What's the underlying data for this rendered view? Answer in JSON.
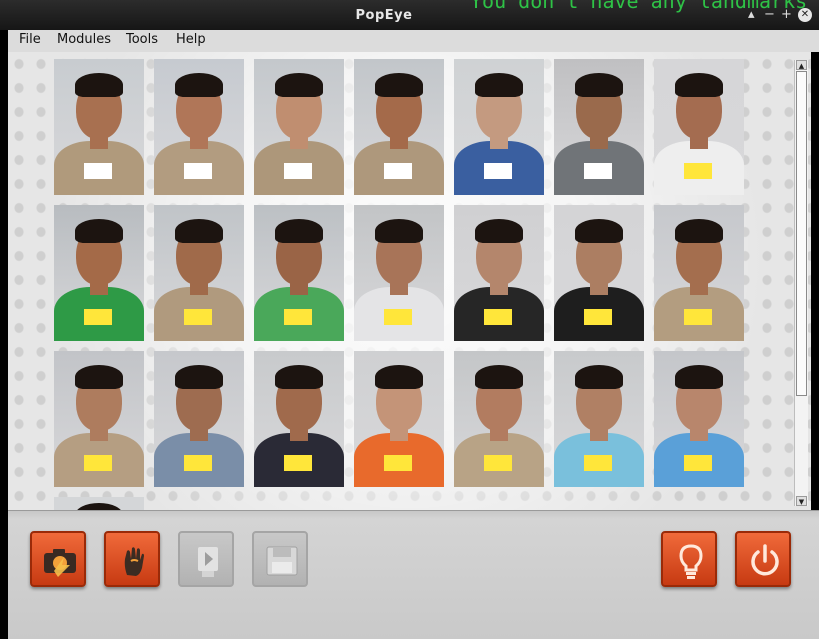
{
  "window": {
    "title": "PopEye",
    "overlay_text": "You don't have any landmarks",
    "controls": {
      "collapse": "▴",
      "minimize": "−",
      "maximize": "+",
      "close": "✕"
    }
  },
  "menu": {
    "items": [
      "File",
      "Modules",
      "Tools",
      "Help"
    ]
  },
  "gallery": {
    "rows": [
      [
        {
          "wall": "#c8ccd0",
          "shirt": "#b09a7c",
          "skin": "#a87050",
          "tag": "#ffffff",
          "tag_text": ""
        },
        {
          "wall": "#c6cad0",
          "shirt": "#b29c80",
          "skin": "#b07658",
          "tag": "#ffffff",
          "tag_text": ""
        },
        {
          "wall": "#c4c8cc",
          "shirt": "#ad977a",
          "skin": "#c08e70",
          "tag": "#ffffff",
          "tag_text": ""
        },
        {
          "wall": "#c2c6ca",
          "shirt": "#ae987c",
          "skin": "#a46a4a",
          "tag": "#ffffff",
          "tag_text": ""
        },
        {
          "wall": "#cfd2d4",
          "shirt": "#3a5fa0",
          "skin": "#c49a80",
          "tag": "#ffffff",
          "tag_text": ""
        },
        {
          "wall": "#c0c0c2",
          "shirt": "#707478",
          "skin": "#9a6a4c",
          "tag": "#ffffff",
          "tag_text": ""
        },
        {
          "wall": "#d6d6d8",
          "shirt": "#eeeeee",
          "skin": "#a46c50",
          "tag": "#ffe63a",
          "tag_text": ""
        }
      ],
      [
        {
          "wall": "#b8bcc0",
          "shirt": "#2e9a46",
          "skin": "#a46a48",
          "tag": "#ffe63a",
          "tag_text": ""
        },
        {
          "wall": "#c0c4c8",
          "shirt": "#b09a7e",
          "skin": "#a06a4a",
          "tag": "#ffe63a",
          "tag_text": ""
        },
        {
          "wall": "#bcc0c4",
          "shirt": "#4aa85a",
          "skin": "#9a6446",
          "tag": "#ffe63a",
          "tag_text": ""
        },
        {
          "wall": "#c2c4c6",
          "shirt": "#e4e4e6",
          "skin": "#a87458",
          "tag": "#ffe63a",
          "tag_text": ""
        },
        {
          "wall": "#d0d0d2",
          "shirt": "#262626",
          "skin": "#b4866c",
          "tag": "#ffe63a",
          "tag_text": ""
        },
        {
          "wall": "#d4d4d6",
          "shirt": "#1e1e1e",
          "skin": "#ac7e62",
          "tag": "#ffe63a",
          "tag_text": ""
        },
        {
          "wall": "#c6c8cc",
          "shirt": "#b39d80",
          "skin": "#a46e4e",
          "tag": "#ffe63a",
          "tag_text": ""
        }
      ],
      [
        {
          "wall": "#c2c4c8",
          "shirt": "#b59e82",
          "skin": "#ae7c5e",
          "tag": "#ffe63a",
          "tag_text": ""
        },
        {
          "wall": "#c6c8cc",
          "shirt": "#7a8ea8",
          "skin": "#9e6c50",
          "tag": "#ffe63a",
          "tag_text": ""
        },
        {
          "wall": "#c8cacc",
          "shirt": "#2a2a36",
          "skin": "#a06a4c",
          "tag": "#ffe63a",
          "tag_text": ""
        },
        {
          "wall": "#cfd0d2",
          "shirt": "#e86a2c",
          "skin": "#c49478",
          "tag": "#ffe63a",
          "tag_text": ""
        },
        {
          "wall": "#c4c6c8",
          "shirt": "#b8a386",
          "skin": "#b27c60",
          "tag": "#ffe63a",
          "tag_text": ""
        },
        {
          "wall": "#c8cacc",
          "shirt": "#7ac0dc",
          "skin": "#b08064",
          "tag": "#ffe63a",
          "tag_text": ""
        },
        {
          "wall": "#c4c6ca",
          "shirt": "#5aa0d8",
          "skin": "#b8866c",
          "tag": "#ffe63a",
          "tag_text": ""
        }
      ]
    ],
    "partial_row_visible": 1
  },
  "toolbar": {
    "buttons": [
      {
        "name": "camera-button",
        "icon": "camera-icon",
        "state": "enabled"
      },
      {
        "name": "hand-button",
        "icon": "hand-icon",
        "state": "enabled"
      },
      {
        "name": "play-button",
        "icon": "play-icon",
        "state": "disabled"
      },
      {
        "name": "save-button",
        "icon": "save-icon",
        "state": "disabled"
      },
      {
        "name": "lightbulb-button",
        "icon": "lightbulb-icon",
        "state": "enabled"
      },
      {
        "name": "power-button",
        "icon": "power-icon",
        "state": "enabled"
      }
    ],
    "accent": "#e2531f"
  }
}
